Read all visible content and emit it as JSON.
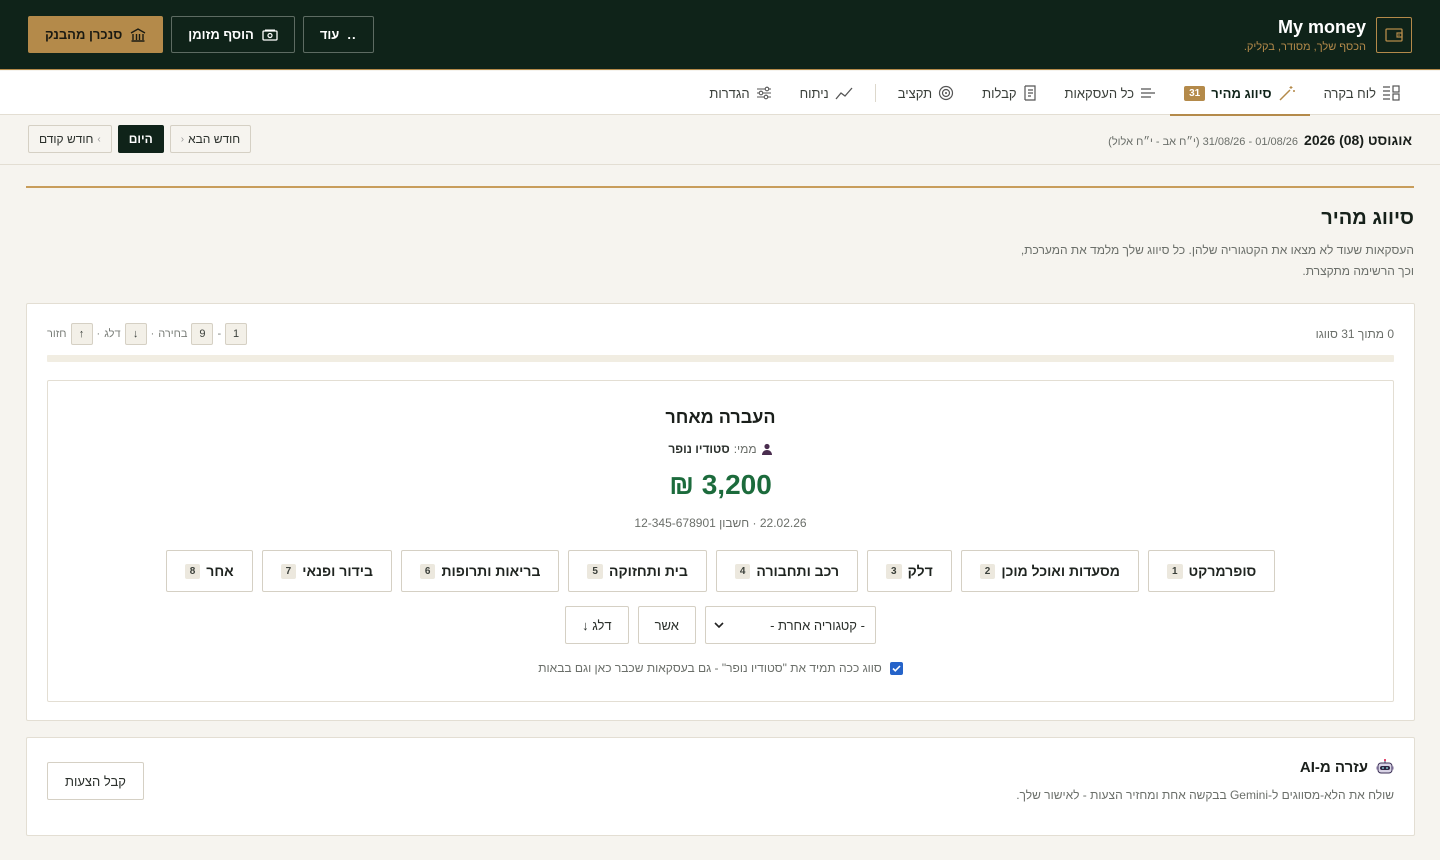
{
  "header": {
    "brand_name": "My money",
    "brand_tagline": "הכסף שלך, מסודר, בקליק.",
    "sync_button": "סנכרן מהבנק",
    "add_cash_button": "הוסף מזומן",
    "more_button": "עוד",
    "more_dots": ".."
  },
  "tabs": [
    {
      "label": "לוח בקרה",
      "icon": "dashboard-icon"
    },
    {
      "label": "סיווג מהיר",
      "icon": "magic-wand-icon",
      "badge": "31",
      "active": true
    },
    {
      "label": "כל העסקאות",
      "icon": "list-icon"
    },
    {
      "label": "קבלות",
      "icon": "receipt-icon"
    },
    {
      "label": "תקציב",
      "icon": "target-icon"
    },
    {
      "label": "ניתוח",
      "icon": "trend-icon"
    },
    {
      "label": "הגדרות",
      "icon": "sliders-icon"
    }
  ],
  "month": {
    "title": "אוגוסט (08) 2026",
    "range": "01/08/26 - 31/08/26 (י״ח אב - י״ח אלול)",
    "prev": "חודש קודם",
    "today": "היום",
    "next": "חודש הבא"
  },
  "section": {
    "title": "סיווג מהיר",
    "description": "העסקאות שעוד לא מצאו את הקטגוריה שלהן. כל סיווג שלך מלמד את המערכת, וכך הרשימה מתקצרת."
  },
  "triage": {
    "progress_text": "0 מתוך 31 סווגו",
    "progress_fraction": 0,
    "shortcuts": {
      "k1": "1",
      "sep": "-",
      "k9": "9",
      "choose": "בחירה",
      "dot": "·",
      "k_down": "↓",
      "skip": "דלג",
      "k_up": "↑",
      "back": "חזור"
    },
    "transaction": {
      "name": "העברה מאחר",
      "from_label": "ממי:",
      "from_value": "סטודיו נופר",
      "amount": "3,200 ₪",
      "meta": "22.02.26 · חשבון 12-345-678901"
    },
    "categories": [
      {
        "label": "סופרמרקט",
        "num": "1"
      },
      {
        "label": "מסעדות ואוכל מוכן",
        "num": "2"
      },
      {
        "label": "דלק",
        "num": "3"
      },
      {
        "label": "רכב ותחבורה",
        "num": "4"
      },
      {
        "label": "בית ותחזוקה",
        "num": "5"
      },
      {
        "label": "בריאות ותרופות",
        "num": "6"
      },
      {
        "label": "בידור ופנאי",
        "num": "7"
      },
      {
        "label": "אחר",
        "num": "8"
      }
    ],
    "other_category_select": "- קטגוריה אחרת -",
    "confirm_button": "אשר",
    "skip_button": "דלג ↓",
    "rule_checkbox_label": "סווג ככה תמיד את \"סטודיו נופר\" - גם בעסקאות שכבר כאן וגם בבאות",
    "rule_checked": true
  },
  "ai": {
    "title": "עזרה מ-AI",
    "description": "שולח את הלא-מסווגים ל-Gemini בבקשה אחת ומחזיר הצעות - לאישור שלך.",
    "button": "קבל הצעות"
  },
  "colors": {
    "header_bg": "#0f2319",
    "accent_gold": "#b48a4a",
    "amount_green": "#1c6b3c",
    "checkbox_blue": "#2563c9"
  }
}
